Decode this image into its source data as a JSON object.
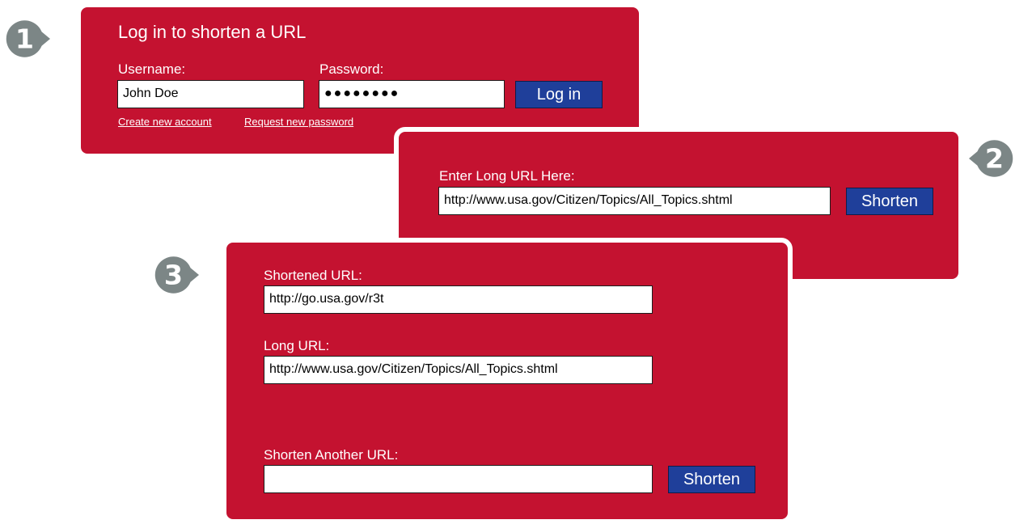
{
  "colors": {
    "panel_red": "#c41230",
    "button_blue": "#1f3f9a",
    "step_gray": "#7c8686"
  },
  "steps": [
    "1",
    "2",
    "3"
  ],
  "login": {
    "title": "Log in to shorten a URL",
    "username_label": "Username:",
    "username_value": "John Doe",
    "password_label": "Password:",
    "password_value": "●●●●●●●●",
    "login_button": "Log in",
    "create_account_link": "Create new account",
    "request_password_link": "Request new password"
  },
  "shorten": {
    "long_url_label": "Enter Long URL Here:",
    "long_url_value": "http://www.usa.gov/Citizen/Topics/All_Topics.shtml",
    "shorten_button": "Shorten"
  },
  "result": {
    "shortened_label": "Shortened URL:",
    "shortened_value": "http://go.usa.gov/r3t",
    "long_label": "Long URL:",
    "long_value": "http://www.usa.gov/Citizen/Topics/All_Topics.shtml",
    "another_label": "Shorten Another URL:",
    "another_value": "",
    "shorten_button": "Shorten"
  }
}
